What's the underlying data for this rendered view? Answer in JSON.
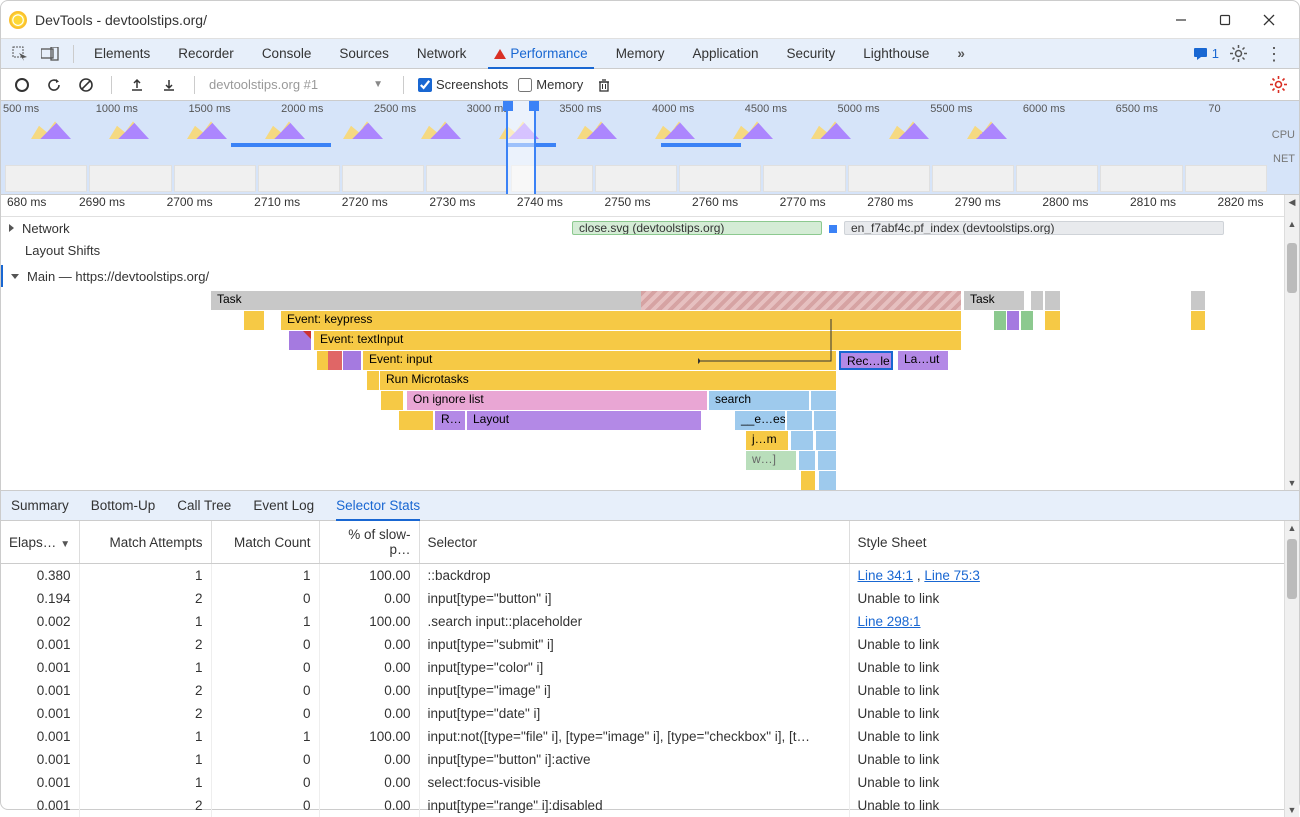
{
  "window_title": "DevTools - devtoolstips.org/",
  "tabs": [
    "Elements",
    "Recorder",
    "Console",
    "Sources",
    "Network",
    "Performance",
    "Memory",
    "Application",
    "Security",
    "Lighthouse"
  ],
  "active_tab": "Performance",
  "issues_count": "1",
  "toolbar": {
    "dropdown": "devtoolstips.org #1",
    "screenshots": "Screenshots",
    "memory": "Memory"
  },
  "overview_ticks": [
    "500 ms",
    "1000 ms",
    "1500 ms",
    "2000 ms",
    "2500 ms",
    "3000 ms",
    "3500 ms",
    "4000 ms",
    "4500 ms",
    "5000 ms",
    "5500 ms",
    "6000 ms",
    "6500 ms",
    "70"
  ],
  "cpu_label": "CPU",
  "net_label": "NET",
  "detail_ticks": [
    "680 ms",
    "2690 ms",
    "2700 ms",
    "2710 ms",
    "2720 ms",
    "2730 ms",
    "2740 ms",
    "2750 ms",
    "2760 ms",
    "2770 ms",
    "2780 ms",
    "2790 ms",
    "2800 ms",
    "2810 ms",
    "2820 ms"
  ],
  "tracks": {
    "network": "Network",
    "layout_shifts": "Layout Shifts",
    "main": "Main — https://devtoolstips.org/"
  },
  "network_reqs": {
    "close_svg": "close.svg (devtoolstips.org)",
    "pf_index": "en_f7abf4c.pf_index (devtoolstips.org)"
  },
  "flame": {
    "task": "Task",
    "event_keypress": "Event: keypress",
    "event_textinput": "Event: textInput",
    "event_input": "Event: input",
    "microtasks": "Run Microtasks",
    "ignore": "On ignore list",
    "r": "R…",
    "layout": "Layout",
    "search": "search",
    "rec": "Rec…le",
    "la": "La…ut",
    "e_es": "__e…es",
    "j_m": "j…m",
    "w": "w…]"
  },
  "bottom_tabs": [
    "Summary",
    "Bottom-Up",
    "Call Tree",
    "Event Log",
    "Selector Stats"
  ],
  "active_bottom_tab": "Selector Stats",
  "table": {
    "headers": {
      "elapsed": "Elaps…",
      "attempts": "Match Attempts",
      "match_count": "Match Count",
      "slow": "% of slow-p…",
      "selector": "Selector",
      "stylesheet": "Style Sheet"
    },
    "rows": [
      {
        "elapsed": "0.380",
        "att": "1",
        "mc": "1",
        "slow": "100.00",
        "sel": "::backdrop",
        "ss_type": "links",
        "ss_links": [
          "Line 34:1",
          "Line 75:3"
        ],
        "sep": " , "
      },
      {
        "elapsed": "0.194",
        "att": "2",
        "mc": "0",
        "slow": "0.00",
        "sel": "input[type=\"button\" i]",
        "ss": "Unable to link"
      },
      {
        "elapsed": "0.002",
        "att": "1",
        "mc": "1",
        "slow": "100.00",
        "sel": ".search input::placeholder",
        "ss_type": "links",
        "ss_links": [
          "Line 298:1"
        ]
      },
      {
        "elapsed": "0.001",
        "att": "2",
        "mc": "0",
        "slow": "0.00",
        "sel": "input[type=\"submit\" i]",
        "ss": "Unable to link"
      },
      {
        "elapsed": "0.001",
        "att": "1",
        "mc": "0",
        "slow": "0.00",
        "sel": "input[type=\"color\" i]",
        "ss": "Unable to link"
      },
      {
        "elapsed": "0.001",
        "att": "2",
        "mc": "0",
        "slow": "0.00",
        "sel": "input[type=\"image\" i]",
        "ss": "Unable to link"
      },
      {
        "elapsed": "0.001",
        "att": "2",
        "mc": "0",
        "slow": "0.00",
        "sel": "input[type=\"date\" i]",
        "ss": "Unable to link"
      },
      {
        "elapsed": "0.001",
        "att": "1",
        "mc": "1",
        "slow": "100.00",
        "sel": "input:not([type=\"file\" i], [type=\"image\" i], [type=\"checkbox\" i], [t…",
        "ss": "Unable to link"
      },
      {
        "elapsed": "0.001",
        "att": "1",
        "mc": "0",
        "slow": "0.00",
        "sel": "input[type=\"button\" i]:active",
        "ss": "Unable to link"
      },
      {
        "elapsed": "0.001",
        "att": "1",
        "mc": "0",
        "slow": "0.00",
        "sel": "select:focus-visible",
        "ss": "Unable to link"
      },
      {
        "elapsed": "0.001",
        "att": "2",
        "mc": "0",
        "slow": "0.00",
        "sel": "input[type=\"range\" i]:disabled",
        "ss": "Unable to link"
      }
    ]
  }
}
